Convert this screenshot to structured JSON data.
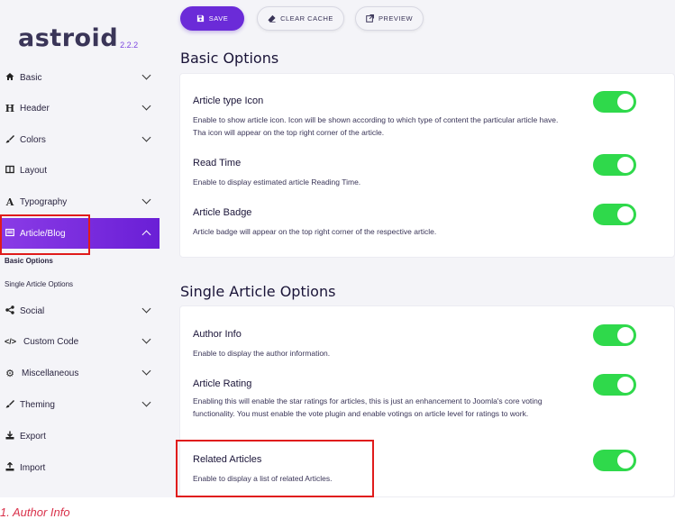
{
  "logo": {
    "name": "astroid",
    "version": "2.2.2"
  },
  "toolbar": {
    "save": "SAVE",
    "clear_cache": "CLEAR CACHE",
    "preview": "PREVIEW"
  },
  "sidebar": {
    "items": [
      {
        "label": "Basic",
        "icon": "home-icon"
      },
      {
        "label": "Header",
        "icon": "heading-icon"
      },
      {
        "label": "Colors",
        "icon": "brush-icon"
      },
      {
        "label": "Layout",
        "icon": "layout-icon"
      },
      {
        "label": "Typography",
        "icon": "typography-icon"
      },
      {
        "label": "Article/Blog",
        "icon": "article-icon",
        "active": true
      },
      {
        "label": "Social",
        "icon": "share-icon"
      },
      {
        "label": "Custom Code",
        "icon": "code-icon"
      },
      {
        "label": "Miscellaneous",
        "icon": "cogs-icon"
      },
      {
        "label": "Theming",
        "icon": "brush-icon"
      },
      {
        "label": "Export",
        "icon": "download-icon"
      },
      {
        "label": "Import",
        "icon": "upload-icon"
      }
    ],
    "subitems": [
      "Basic Options",
      "Single Article Options"
    ]
  },
  "basic": {
    "title": "Basic Options",
    "options": [
      {
        "title": "Article type Icon",
        "desc": "Enable to show article icon. Icon will be shown according to which type of content the particular article have. Tha icon will appear on the top right corner of the article.",
        "on": true
      },
      {
        "title": "Read Time",
        "desc": "Enable to display estimated article Reading Time.",
        "on": true
      },
      {
        "title": "Article Badge",
        "desc": "Article badge will appear on the top right corner of the respective article.",
        "on": true
      }
    ]
  },
  "single": {
    "title": "Single Article Options",
    "options": [
      {
        "title": "Author Info",
        "desc": "Enable to display the author information.",
        "on": true
      },
      {
        "title": "Article Rating",
        "desc": "Enabling this will enable the star ratings for articles, this is just an enhancement to Joomla's core voting functionality. You must enable the vote plugin and enable votings on article level for ratings to work.",
        "on": true
      },
      {
        "title": "Related Articles",
        "desc": "Enable to display a list of related Articles.",
        "on": true
      }
    ]
  },
  "caption": "1. Author Info",
  "colors": {
    "accent": "#6b2bd8",
    "toggle_on": "#2fd94b",
    "highlight": "#e01b1b"
  }
}
